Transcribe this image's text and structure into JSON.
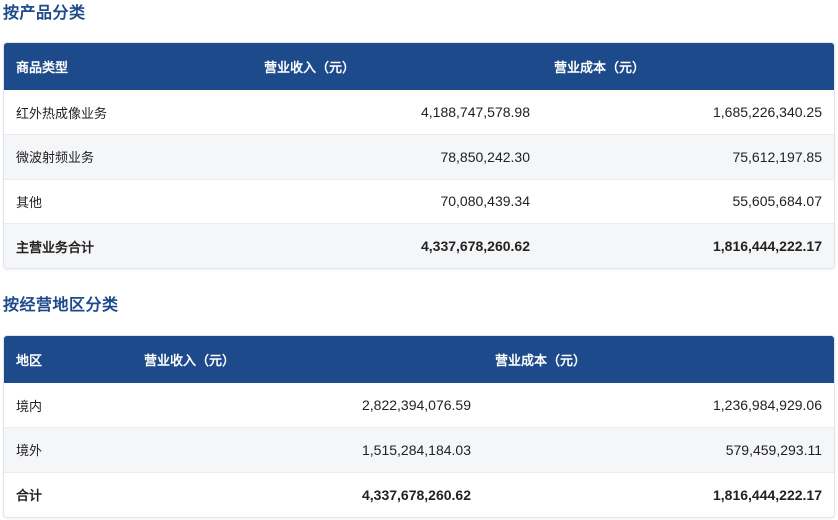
{
  "product_section": {
    "title": "按产品分类",
    "headers": [
      "商品类型",
      "营业收入（元）",
      "营业成本（元）"
    ],
    "rows": [
      {
        "name": "红外热成像业务",
        "revenue": "4,188,747,578.98",
        "cost": "1,685,226,340.25"
      },
      {
        "name": "微波射频业务",
        "revenue": "78,850,242.30",
        "cost": "75,612,197.85"
      },
      {
        "name": "其他",
        "revenue": "70,080,439.34",
        "cost": "55,605,684.07"
      }
    ],
    "total": {
      "name": "主营业务合计",
      "revenue": "4,337,678,260.62",
      "cost": "1,816,444,222.17"
    }
  },
  "region_section": {
    "title": "按经营地区分类",
    "headers": [
      "地区",
      "营业收入（元）",
      "营业成本（元）"
    ],
    "rows": [
      {
        "name": "境内",
        "revenue": "2,822,394,076.59",
        "cost": "1,236,984,929.06"
      },
      {
        "name": "境外",
        "revenue": "1,515,284,184.03",
        "cost": "579,459,293.11"
      }
    ],
    "total": {
      "name": "合计",
      "revenue": "4,337,678,260.62",
      "cost": "1,816,444,222.17"
    }
  },
  "colors": {
    "header_bg": "#1c4a8a",
    "title_color": "#1c4a8a",
    "alt_row_bg": "#f5f6f8"
  }
}
